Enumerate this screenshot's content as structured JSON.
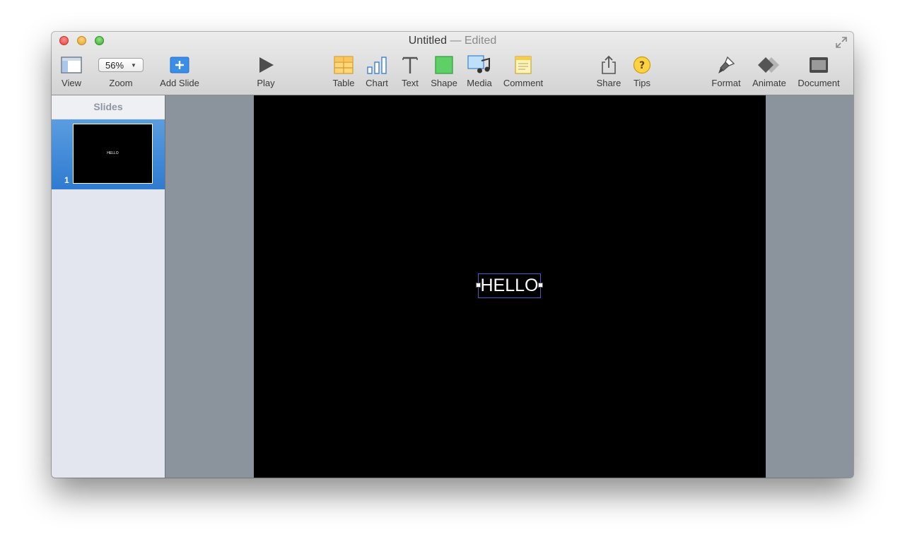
{
  "window": {
    "title": "Untitled",
    "title_suffix": "— Edited"
  },
  "toolbar": {
    "view_label": "View",
    "zoom_label": "Zoom",
    "zoom_value": "56%",
    "add_slide_label": "Add Slide",
    "play_label": "Play",
    "table_label": "Table",
    "chart_label": "Chart",
    "text_label": "Text",
    "shape_label": "Shape",
    "media_label": "Media",
    "comment_label": "Comment",
    "share_label": "Share",
    "tips_label": "Tips",
    "format_label": "Format",
    "animate_label": "Animate",
    "document_label": "Document"
  },
  "sidebar": {
    "header": "Slides",
    "slides": [
      {
        "number": "1",
        "text": "HELLO"
      }
    ]
  },
  "canvas": {
    "textbox_text": "HELLO"
  },
  "colors": {
    "selection": "#2f7bd1",
    "canvas_bg": "#8b939c",
    "slide_bg": "#000000",
    "accent_blue": "#3a8ee6"
  }
}
